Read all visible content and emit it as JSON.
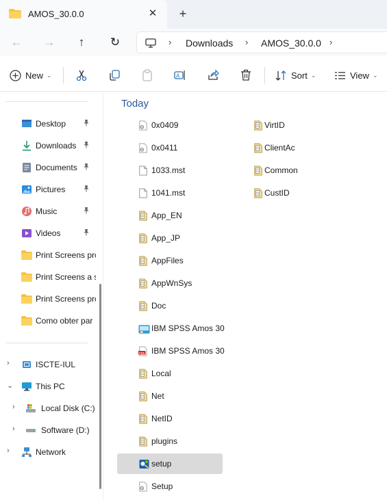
{
  "tab": {
    "title": "AMOS_30.0.0",
    "close": "✕",
    "new": "+"
  },
  "nav": {
    "back": "←",
    "forward": "→",
    "up": "↑",
    "refresh": "↻"
  },
  "breadcrumb": {
    "sep": "›",
    "items": [
      "Downloads",
      "AMOS_30.0.0"
    ]
  },
  "commands": {
    "new": "New",
    "sort": "Sort",
    "view": "View",
    "chevron": "⌄"
  },
  "sidebar": {
    "pin": "📌",
    "quick_access": [
      {
        "label": "Desktop",
        "icon": "desktop-icon"
      },
      {
        "label": "Downloads",
        "icon": "download-icon"
      },
      {
        "label": "Documents",
        "icon": "documents-icon"
      },
      {
        "label": "Pictures",
        "icon": "pictures-icon"
      },
      {
        "label": "Music",
        "icon": "music-icon"
      },
      {
        "label": "Videos",
        "icon": "videos-icon"
      },
      {
        "label": "Print Screens pro",
        "icon": "folder-icon"
      },
      {
        "label": "Print Screens a se",
        "icon": "folder-icon"
      },
      {
        "label": "Print Screens pro",
        "icon": "folder-icon"
      },
      {
        "label": "Como obter par",
        "icon": "folder-icon"
      }
    ],
    "tree": [
      {
        "label": "ISCTE-IUL",
        "expander": "›"
      },
      {
        "label": "This PC",
        "expander": "⌄"
      },
      {
        "label": "Local Disk (C:)",
        "expander": "›"
      },
      {
        "label": "Software (D:)",
        "expander": "›"
      },
      {
        "label": "Network",
        "expander": "›"
      }
    ]
  },
  "content": {
    "group": "Today",
    "col1": [
      {
        "name": "0x0409",
        "icon": "settings-file-icon"
      },
      {
        "name": "0x0411",
        "icon": "settings-file-icon"
      },
      {
        "name": "1033.mst",
        "icon": "blank-file-icon"
      },
      {
        "name": "1041.mst",
        "icon": "blank-file-icon"
      },
      {
        "name": "App_EN",
        "icon": "cab-file-icon"
      },
      {
        "name": "App_JP",
        "icon": "cab-file-icon"
      },
      {
        "name": "AppFiles",
        "icon": "cab-file-icon"
      },
      {
        "name": "AppWnSys",
        "icon": "cab-file-icon"
      },
      {
        "name": "Doc",
        "icon": "cab-file-icon"
      },
      {
        "name": "IBM SPSS Amos 30",
        "icon": "installer-icon"
      },
      {
        "name": "IBM SPSS Amos 30",
        "icon": "pdf-icon"
      },
      {
        "name": "Local",
        "icon": "cab-file-icon"
      },
      {
        "name": "Net",
        "icon": "cab-file-icon"
      },
      {
        "name": "NetID",
        "icon": "cab-file-icon"
      },
      {
        "name": "plugins",
        "icon": "cab-file-icon"
      },
      {
        "name": "setup",
        "icon": "setup-exe-icon",
        "selected": true
      },
      {
        "name": "Setup",
        "icon": "settings-file-icon"
      }
    ],
    "col2": [
      {
        "name": "VirtID",
        "icon": "cab-file-icon"
      },
      {
        "name": "ClientAc",
        "icon": "cab-file-icon"
      },
      {
        "name": "Common",
        "icon": "cab-file-icon"
      },
      {
        "name": "CustID",
        "icon": "cab-file-icon"
      }
    ]
  }
}
